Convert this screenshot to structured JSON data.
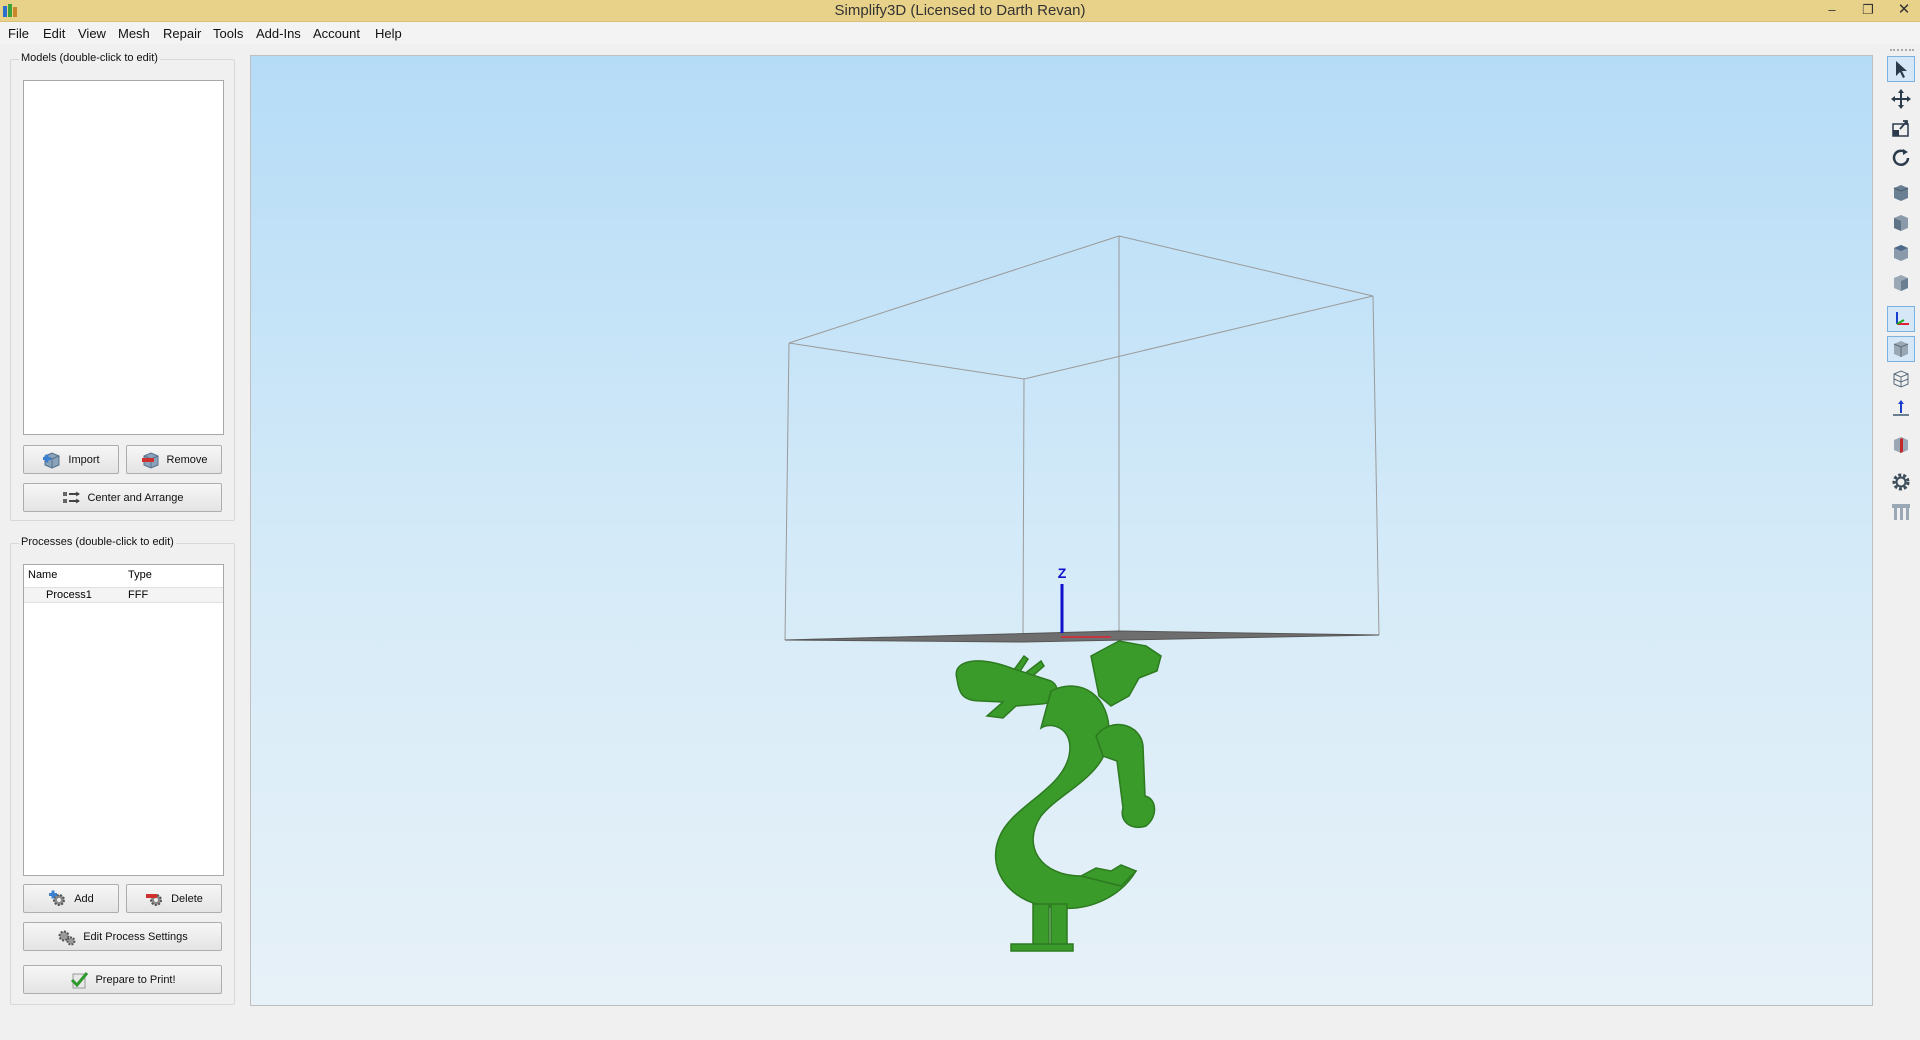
{
  "window": {
    "title": "Simplify3D (Licensed to Darth Revan)",
    "minimize": "–",
    "maximize": "❐",
    "close": "✕"
  },
  "menu": [
    "File",
    "Edit",
    "View",
    "Mesh",
    "Repair",
    "Tools",
    "Add-Ins",
    "Account",
    "Help"
  ],
  "models_panel": {
    "title": "Models (double-click to edit)",
    "items": [],
    "import_label": "Import",
    "remove_label": "Remove",
    "center_label": "Center and Arrange"
  },
  "processes_panel": {
    "title": "Processes (double-click to edit)",
    "columns": [
      "Name",
      "Type"
    ],
    "rows": [
      {
        "name": "Process1",
        "type": "FFF"
      }
    ],
    "add_label": "Add",
    "delete_label": "Delete",
    "edit_label": "Edit Process Settings",
    "prepare_label": "Prepare to Print!"
  },
  "viewport": {
    "axis_label": "Z",
    "model_color": "#3a9a2a"
  },
  "right_toolbar": [
    "select-icon",
    "move-icon",
    "scale-icon",
    "rotate-icon",
    "view-default-icon",
    "view-front-icon",
    "view-top-icon",
    "view-side-icon",
    "show-axes-icon",
    "show-build-volume-icon",
    "wireframe-icon",
    "normals-icon",
    "cross-section-icon",
    "settings-gear-icon",
    "supports-icon"
  ]
}
